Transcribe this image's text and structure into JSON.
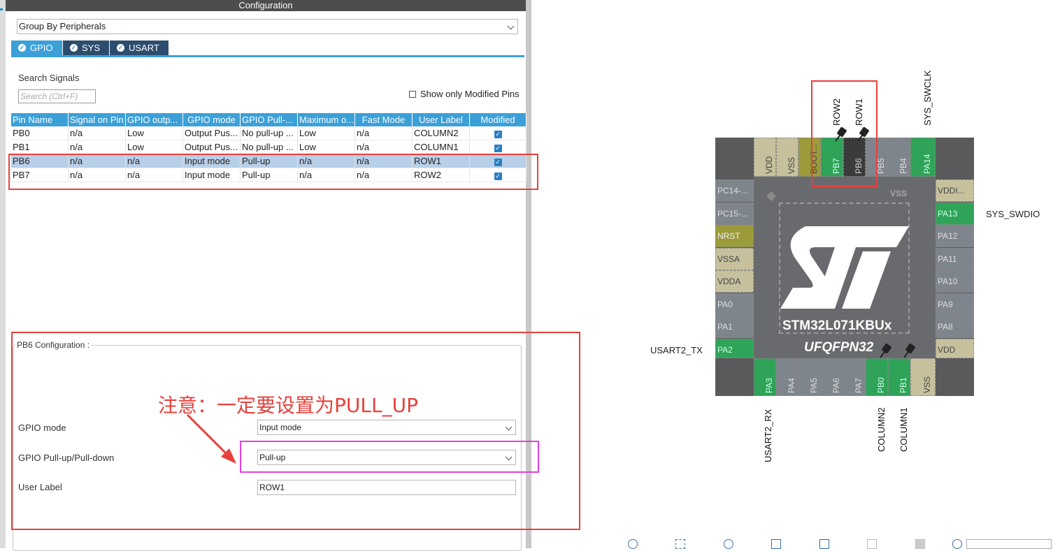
{
  "config_title": "Configuration",
  "group_by": "Group By Peripherals",
  "tabs": [
    "GPIO",
    "SYS",
    "USART"
  ],
  "search": {
    "label": "Search Signals",
    "placeholder": "Search (Ctrl+F)"
  },
  "show_modified": "Show only Modified Pins",
  "table": {
    "headers": [
      "Pin Name",
      "Signal on Pin",
      "GPIO outp...",
      "GPIO mode",
      "GPIO Pull-...",
      "Maximum o...",
      "Fast Mode",
      "User Label",
      "Modified"
    ],
    "rows": [
      {
        "pin": "PB0",
        "signal": "n/a",
        "output": "Low",
        "mode": "Output Pus...",
        "pull": "No pull-up ...",
        "max": "Low",
        "fast": "n/a",
        "label": "COLUMN2"
      },
      {
        "pin": "PB1",
        "signal": "n/a",
        "output": "Low",
        "mode": "Output Pus...",
        "pull": "No pull-up ...",
        "max": "Low",
        "fast": "n/a",
        "label": "COLUMN1"
      },
      {
        "pin": "PB6",
        "signal": "n/a",
        "output": "n/a",
        "mode": "Input mode",
        "pull": "Pull-up",
        "max": "n/a",
        "fast": "n/a",
        "label": "ROW1"
      },
      {
        "pin": "PB7",
        "signal": "n/a",
        "output": "n/a",
        "mode": "Input mode",
        "pull": "Pull-up",
        "max": "n/a",
        "fast": "n/a",
        "label": "ROW2"
      }
    ]
  },
  "pin_config": {
    "title": "PB6 Configuration :",
    "gpio_mode_label": "GPIO mode",
    "gpio_mode_value": "Input mode",
    "pull_label": "GPIO Pull-up/Pull-down",
    "pull_value": "Pull-up",
    "user_label_label": "User Label",
    "user_label_value": "ROW1"
  },
  "annotation": "注意：一定要设置为PULL_UP",
  "chip": {
    "name": "STM32L071KBUx",
    "package": "UFQFPN32",
    "center_label": "VSS",
    "top_pins": [
      "VDD",
      "VSS",
      "BOOT...",
      "PB7",
      "PB6",
      "PB5",
      "PB4",
      "PA14"
    ],
    "left_pins": [
      "PC14-...",
      "PC15-...",
      "NRST",
      "VSSA",
      "VDDA",
      "PA0",
      "PA1",
      "PA2"
    ],
    "right_pins": [
      "VDDI...",
      "PA13",
      "PA12",
      "PA11",
      "PA10",
      "PA9",
      "PA8",
      "VDD"
    ],
    "bottom_pins": [
      "PA3",
      "PA4",
      "PA5",
      "PA6",
      "PA7",
      "PB0",
      "PB1",
      "VSS"
    ],
    "signals": {
      "row2": "ROW2",
      "row1": "ROW1",
      "sys_swclk": "SYS_SWCLK",
      "sys_swdio": "SYS_SWDIO",
      "usart2_tx": "USART2_TX",
      "usart2_rx": "USART2_RX",
      "column2": "COLUMN2",
      "column1": "COLUMN1"
    }
  },
  "colors": {
    "header_bg": "#4d4d4d",
    "tab_active": "#3ca0d8",
    "tab_inactive": "#2c4d6e",
    "pin_green": "#2fa357",
    "pin_olive": "#9c9b3a",
    "pin_beige": "#c6c09d",
    "pin_gray": "#7f858c",
    "chip_body": "#5c5c5e",
    "annotation_red": "#e8403c",
    "highlight_magenta": "#e040e0"
  }
}
